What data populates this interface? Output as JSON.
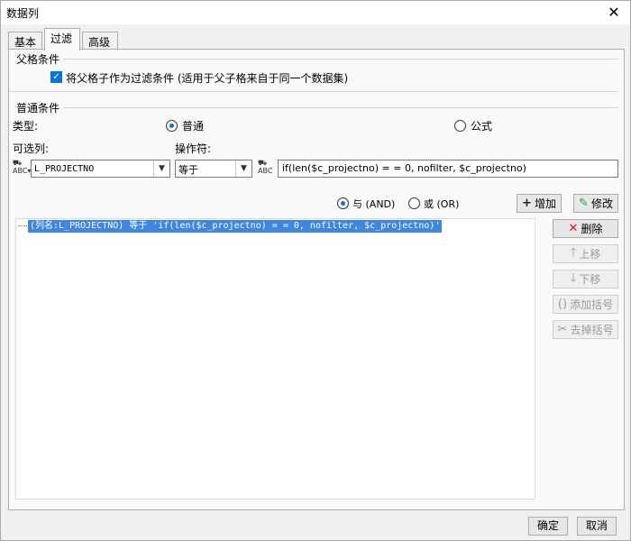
{
  "window": {
    "title": "数据列"
  },
  "tabs": [
    {
      "label": "基本"
    },
    {
      "label": "过滤"
    },
    {
      "label": "高级"
    }
  ],
  "parent_condition": {
    "section_title": "父格条件",
    "checkbox_label": "将父格子作为过滤条件 (适用于父子格来自于同一个数据集)",
    "checked": true
  },
  "common_condition": {
    "section_title": "普通条件",
    "type_label": "类型:",
    "type_options": [
      "普通",
      "公式"
    ],
    "type_selected": "普通",
    "column_label": "可选列:",
    "operator_label": "操作符:",
    "column_value": "L_PROJECTNO",
    "operator_value": "等于",
    "formula_value": "if(len($c_projectno) = = 0, nofilter, $c_projectno)",
    "logic_options": [
      "与 (AND)",
      "或 (OR)"
    ],
    "logic_selected": "与 (AND)",
    "add_button": "增加",
    "modify_button": "修改"
  },
  "conditions_list": [
    "(列名:L_PROJECTNO) 等于 'if(len($c_projectno) = = 0, nofilter, $c_projectno)'"
  ],
  "side_buttons": {
    "delete": "删除",
    "move_up": "上移",
    "move_down": "下移",
    "add_bracket": "添加括号",
    "remove_bracket": "去掉括号"
  },
  "footer": {
    "ok": "确定",
    "cancel": "取消"
  },
  "colors": {
    "accent": "#0078d7",
    "selection": "#3f87dd",
    "delete_icon": "#e81123",
    "add_icon": "#222222",
    "modify_icon": "#2e9e3e"
  },
  "icons": {
    "close": "close-icon",
    "column_type": "abc-field-icon",
    "formula_type": "abc-formula-icon",
    "add": "plus-icon",
    "modify": "edit-icon",
    "delete": "x-icon",
    "move_up": "arrow-up-icon",
    "move_down": "arrow-down-icon",
    "add_bracket": "bracket-icon",
    "remove_bracket": "remove-bracket-icon"
  }
}
